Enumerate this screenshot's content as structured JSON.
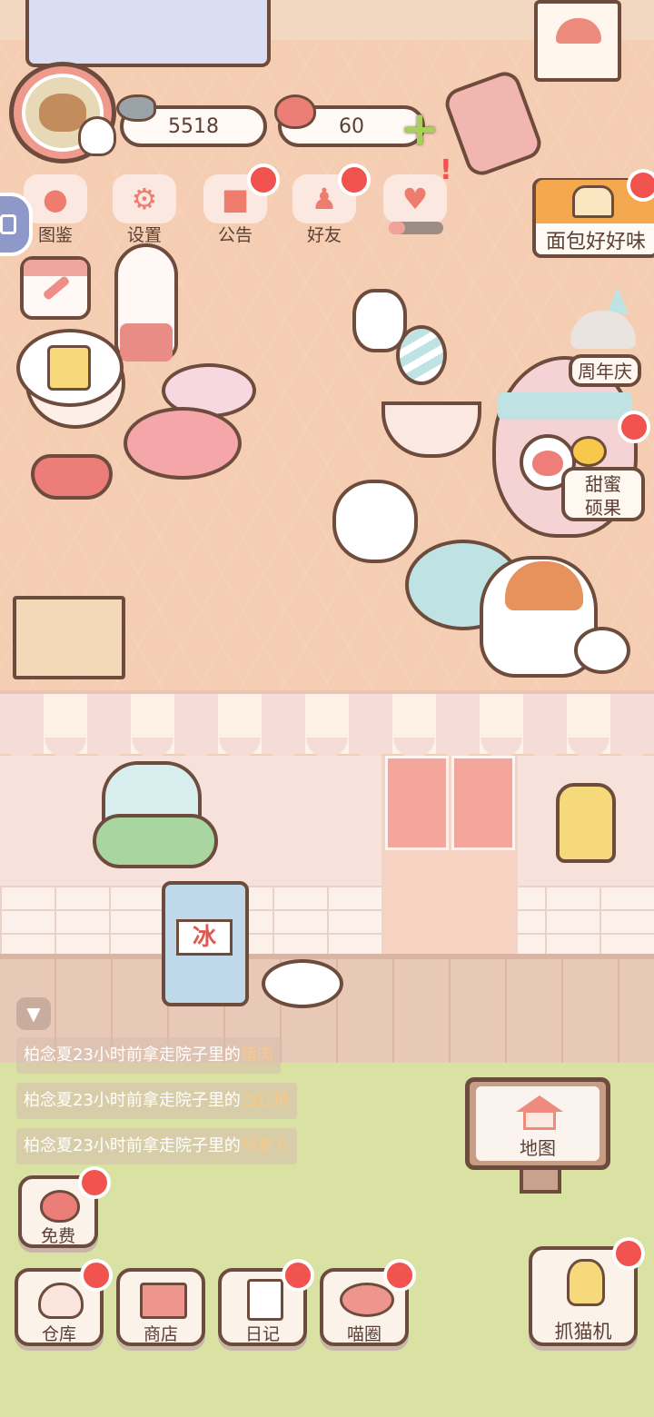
{
  "colors": {
    "accent_red": "#f1534e",
    "outline": "#6d4c3d",
    "floor": "#f5cdb2",
    "lawn": "#d9e1a3",
    "log_highlight": "#f7c989"
  },
  "player": {
    "avatar_icon": "bear-avatar-icon"
  },
  "currency": {
    "coins": "5518",
    "coins_icon": "fish-icon",
    "hearts": "60",
    "hearts_icon": "heart-icon",
    "add_icon": "plus-icon"
  },
  "top_menu": [
    {
      "label": "图鉴",
      "icon": "cat-head-icon",
      "badge": false
    },
    {
      "label": "设置",
      "icon": "gear-icon",
      "badge": false
    },
    {
      "label": "公告",
      "icon": "gift-icon",
      "badge": true
    },
    {
      "label": "好友",
      "icon": "friends-icon",
      "badge": true
    },
    {
      "label": "",
      "icon": "heart-event-icon",
      "badge": true,
      "progress": 0.3
    }
  ],
  "banners": {
    "bread": "面包好好味",
    "anniversary": "周年庆",
    "sweet_fruit_line1": "甜蜜",
    "sweet_fruit_line2": "硕果"
  },
  "ice_sign": "冰",
  "activity_log": [
    {
      "prefix": "柏念夏23小时前拿走院子里的",
      "item": "猪肉"
    },
    {
      "prefix": "柏念夏23小时前拿走院子里的",
      "item": "西红柿"
    },
    {
      "prefix": "柏念夏23小时前拿走院子里的",
      "item": "胡萝卜"
    }
  ],
  "map_label": "地图",
  "bottom_buttons": {
    "free": "免费",
    "warehouse": "仓库",
    "shop": "商店",
    "diary": "日记",
    "meow": "喵圈",
    "claw": "抓猫机"
  }
}
